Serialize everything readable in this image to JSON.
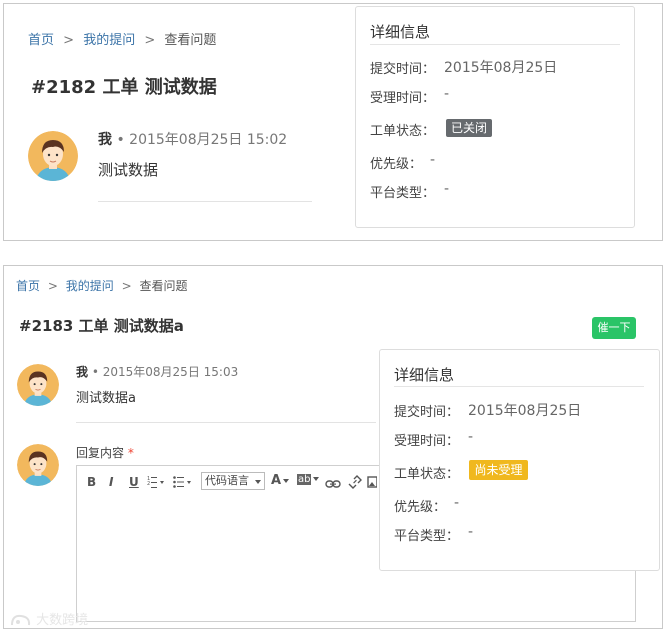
{
  "screen1": {
    "breadcrumb": {
      "home": "首页",
      "my_questions": "我的提问",
      "current": "查看问题",
      "separator": ">"
    },
    "title": "#2182 工单 测试数据",
    "post": {
      "author": "我",
      "time": "• 2015年08月25日 15:02",
      "content": "测试数据"
    },
    "info": {
      "title": "详细信息",
      "submit_time_label": "提交时间：",
      "submit_time_value": "2015年08月25日",
      "accept_time_label": "受理时间：",
      "accept_time_value": "-",
      "status_label": "工单状态：",
      "status_value": "已关闭",
      "priority_label": "优先级：",
      "priority_value": "-",
      "platform_label": "平台类型：",
      "platform_value": "-"
    }
  },
  "screen2": {
    "breadcrumb": {
      "home": "首页",
      "my_questions": "我的提问",
      "current": "查看问题",
      "separator": ">"
    },
    "title": "#2183 工单 测试数据a",
    "urge_button": "催一下",
    "post": {
      "author": "我",
      "time": "• 2015年08月25日 15:03",
      "content": "测试数据a"
    },
    "reply": {
      "label": "回复内容",
      "required_mark": "*",
      "toolbar": {
        "bold": "B",
        "italic": "I",
        "underline": "U",
        "code_language": "代码语言",
        "font_color": "A",
        "highlight": "ab"
      }
    },
    "info": {
      "title": "详细信息",
      "submit_time_label": "提交时间：",
      "submit_time_value": "2015年08月25日",
      "accept_time_label": "受理时间：",
      "accept_time_value": "-",
      "status_label": "工单状态：",
      "status_value": "尚未受理",
      "priority_label": "优先级：",
      "priority_value": "-",
      "platform_label": "平台类型：",
      "platform_value": "-"
    }
  },
  "watermark": "大数跨境",
  "icons": [
    "avatar-icon",
    "ordered-list-icon",
    "unordered-list-icon",
    "link-icon",
    "unlink-icon",
    "image-icon",
    "watermark-logo-icon"
  ],
  "colors": {
    "link": "#3c74a8",
    "closed_badge": "#666a6e",
    "pending_badge": "#f0b81e",
    "urge_button": "#2ac467",
    "required": "#ee4433"
  }
}
